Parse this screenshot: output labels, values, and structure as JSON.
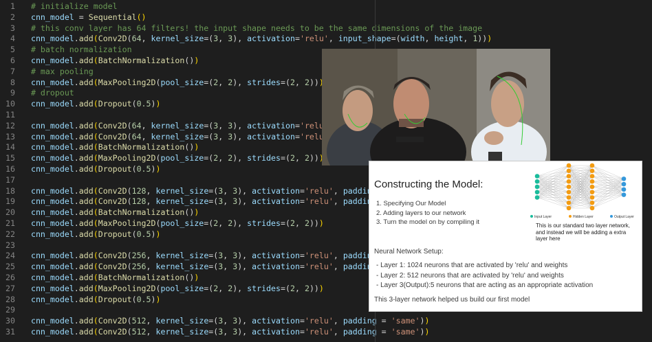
{
  "editor": {
    "lines": [
      {
        "n": "1",
        "html": "  <span class='c'># initialize model</span>"
      },
      {
        "n": "2",
        "html": "  <span class='k'>cnn_model</span> = <span class='f'>Sequential</span><span class='b'>()</span>"
      },
      {
        "n": "3",
        "html": "  <span class='c'># this conv layer has 64 filters! the input shape needs to be the same dimensions of the image</span>"
      },
      {
        "n": "4",
        "html": "  <span class='k'>cnn_model</span>.<span class='f'>add</span><span class='b'>(</span><span class='f'>Conv2D</span>(<span class='n'>64</span>, <span class='k'>kernel_size</span>=(<span class='n'>3</span>, <span class='n'>3</span>), <span class='k'>activation</span>=<span class='s'>'relu'</span>, <span class='k'>input_shape</span>=(<span class='k'>width</span>, <span class='k'>height</span>, <span class='n'>1</span>))<span class='b'>)</span>"
      },
      {
        "n": "5",
        "html": "  <span class='c'># batch normalization</span>"
      },
      {
        "n": "6",
        "html": "  <span class='k'>cnn_model</span>.<span class='f'>add</span><span class='b'>(</span><span class='f'>BatchNormalization</span>()<span class='b'>)</span>"
      },
      {
        "n": "7",
        "html": "  <span class='c'># max pooling</span>"
      },
      {
        "n": "8",
        "html": "  <span class='k'>cnn_model</span>.<span class='f'>add</span><span class='b'>(</span><span class='f'>MaxPooling2D</span>(<span class='k'>pool_size</span>=(<span class='n'>2</span>, <span class='n'>2</span>), <span class='k'>strides</span>=(<span class='n'>2</span>, <span class='n'>2</span>))<span class='b'>)</span>"
      },
      {
        "n": "9",
        "html": "  <span class='c'># dropout</span>"
      },
      {
        "n": "10",
        "html": "  <span class='k'>cnn_model</span>.<span class='f'>add</span><span class='b'>(</span><span class='f'>Dropout</span>(<span class='n'>0.5</span>)<span class='b'>)</span>"
      },
      {
        "n": "11",
        "html": ""
      },
      {
        "n": "12",
        "html": "  <span class='k'>cnn_model</span>.<span class='f'>add</span><span class='b'>(</span><span class='f'>Conv2D</span>(<span class='n'>64</span>, <span class='k'>kernel_size</span>=(<span class='n'>3</span>, <span class='n'>3</span>), <span class='k'>activation</span>=<span class='s'>'relu'</span>, <span class='k'>input</span>"
      },
      {
        "n": "13",
        "html": "  <span class='k'>cnn_model</span>.<span class='f'>add</span><span class='b'>(</span><span class='f'>Conv2D</span>(<span class='n'>64</span>, <span class='k'>kernel_size</span>=(<span class='n'>3</span>, <span class='n'>3</span>), <span class='k'>activation</span>=<span class='s'>'relu'</span>, <span class='k'>paddi</span>"
      },
      {
        "n": "14",
        "html": "  <span class='k'>cnn_model</span>.<span class='f'>add</span><span class='b'>(</span><span class='f'>BatchNormalization</span>()<span class='b'>)</span>"
      },
      {
        "n": "15",
        "html": "  <span class='k'>cnn_model</span>.<span class='f'>add</span><span class='b'>(</span><span class='f'>MaxPooling2D</span>(<span class='k'>pool_size</span>=(<span class='n'>2</span>, <span class='n'>2</span>), <span class='k'>strides</span>=(<span class='n'>2</span>, <span class='n'>2</span>))<span class='b'>)</span>"
      },
      {
        "n": "16",
        "html": "  <span class='k'>cnn_model</span>.<span class='f'>add</span><span class='b'>(</span><span class='f'>Dropout</span>(<span class='n'>0.5</span>)<span class='b'>)</span>"
      },
      {
        "n": "17",
        "html": ""
      },
      {
        "n": "18",
        "html": "  <span class='k'>cnn_model</span>.<span class='f'>add</span><span class='b'>(</span><span class='f'>Conv2D</span>(<span class='n'>128</span>, <span class='k'>kernel_size</span>=(<span class='n'>3</span>, <span class='n'>3</span>), <span class='k'>activation</span>=<span class='s'>'relu'</span>, <span class='k'>padding</span> = <span class='s'>'sam</span>"
      },
      {
        "n": "19",
        "html": "  <span class='k'>cnn_model</span>.<span class='f'>add</span><span class='b'>(</span><span class='f'>Conv2D</span>(<span class='n'>128</span>, <span class='k'>kernel_size</span>=(<span class='n'>3</span>, <span class='n'>3</span>), <span class='k'>activation</span>=<span class='s'>'relu'</span>, <span class='k'>padding</span> = <span class='s'>'sam</span>"
      },
      {
        "n": "20",
        "html": "  <span class='k'>cnn_model</span>.<span class='f'>add</span><span class='b'>(</span><span class='f'>BatchNormalization</span>()<span class='b'>)</span>"
      },
      {
        "n": "21",
        "html": "  <span class='k'>cnn_model</span>.<span class='f'>add</span><span class='b'>(</span><span class='f'>MaxPooling2D</span>(<span class='k'>pool_size</span>=(<span class='n'>2</span>, <span class='n'>2</span>), <span class='k'>strides</span>=(<span class='n'>2</span>, <span class='n'>2</span>))<span class='b'>)</span>"
      },
      {
        "n": "22",
        "html": "  <span class='k'>cnn_model</span>.<span class='f'>add</span><span class='b'>(</span><span class='f'>Dropout</span>(<span class='n'>0.5</span>)<span class='b'>)</span>"
      },
      {
        "n": "23",
        "html": ""
      },
      {
        "n": "24",
        "html": "  <span class='k'>cnn_model</span>.<span class='f'>add</span><span class='b'>(</span><span class='f'>Conv2D</span>(<span class='n'>256</span>, <span class='k'>kernel_size</span>=(<span class='n'>3</span>, <span class='n'>3</span>), <span class='k'>activation</span>=<span class='s'>'relu'</span>, <span class='k'>padding</span> = <span class='s'>'sam</span>"
      },
      {
        "n": "25",
        "html": "  <span class='k'>cnn_model</span>.<span class='f'>add</span><span class='b'>(</span><span class='f'>Conv2D</span>(<span class='n'>256</span>, <span class='k'>kernel_size</span>=(<span class='n'>3</span>, <span class='n'>3</span>), <span class='k'>activation</span>=<span class='s'>'relu'</span>, <span class='k'>padding</span> = <span class='s'>'sam</span>"
      },
      {
        "n": "26",
        "html": "  <span class='k'>cnn_model</span>.<span class='f'>add</span><span class='b'>(</span><span class='f'>BatchNormalization</span>()<span class='b'>)</span>"
      },
      {
        "n": "27",
        "html": "  <span class='k'>cnn_model</span>.<span class='f'>add</span><span class='b'>(</span><span class='f'>MaxPooling2D</span>(<span class='k'>pool_size</span>=(<span class='n'>2</span>, <span class='n'>2</span>), <span class='k'>strides</span>=(<span class='n'>2</span>, <span class='n'>2</span>))<span class='b'>)</span>"
      },
      {
        "n": "28",
        "html": "  <span class='k'>cnn_model</span>.<span class='f'>add</span><span class='b'>(</span><span class='f'>Dropout</span>(<span class='n'>0.5</span>)<span class='b'>)</span>"
      },
      {
        "n": "29",
        "html": ""
      },
      {
        "n": "30",
        "html": "  <span class='k'>cnn_model</span>.<span class='f'>add</span><span class='b'>(</span><span class='f'>Conv2D</span>(<span class='n'>512</span>, <span class='k'>kernel_size</span>=(<span class='n'>3</span>, <span class='n'>3</span>), <span class='k'>activation</span>=<span class='s'>'relu'</span>, <span class='k'>padding</span> = <span class='s'>'same'</span>)<span class='b'>)</span>"
      },
      {
        "n": "31",
        "html": "  <span class='k'>cnn_model</span>.<span class='f'>add</span><span class='b'>(</span><span class='f'>Conv2D</span>(<span class='n'>512</span>, <span class='k'>kernel_size</span>=(<span class='n'>3</span>, <span class='n'>3</span>), <span class='k'>activation</span>=<span class='s'>'relu'</span>, <span class='k'>padding</span> = <span class='s'>'same'</span>)<span class='b'>)</span>"
      }
    ]
  },
  "slide": {
    "title": "Constructing the Model:",
    "steps": [
      "1.   Specifying Our Model",
      "2.   Adding layers to our network",
      "3.   Turn the model on by compiling it"
    ],
    "nn_caption": "This is our standard two layer network, and instead we will be adding a extra layer here",
    "legend": [
      "Input Layer",
      "Hidden Layer",
      "Output Layer"
    ],
    "setup": "Neural Network Setup:",
    "bullets": [
      "-   Layer 1: 1024 neurons that are activated by 'relu' and weights",
      "-   Layer 2: 512 neurons that are activated by 'relu' and weights",
      "-   Layer 3(Output):5 neurons that are acting as an appropriate activation"
    ],
    "footer": "This 3-layer network helped us build our first model",
    "colors": {
      "input": "#1abc9c",
      "hidden": "#f39c12",
      "output": "#3498db"
    }
  }
}
